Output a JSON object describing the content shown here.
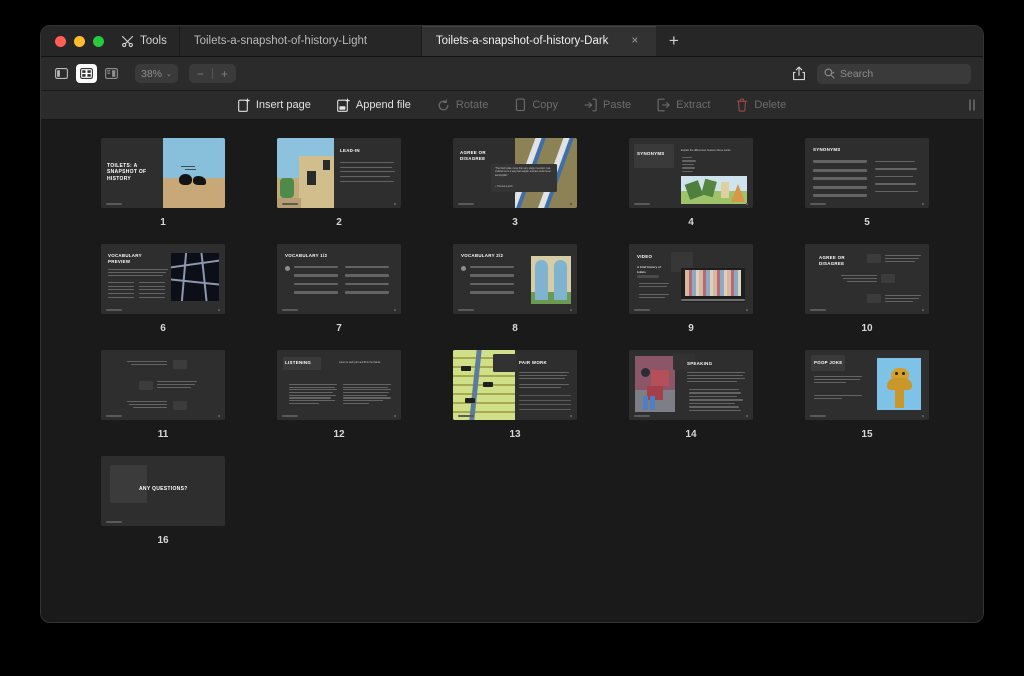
{
  "window": {
    "traffic_lights": [
      "close",
      "minimize",
      "maximize"
    ],
    "tools_label": "Tools",
    "tabs": [
      {
        "label": "Toilets-a-snapshot-of-history-Light",
        "active": false,
        "closable": false
      },
      {
        "label": "Toilets-a-snapshot-of-history-Dark",
        "active": true,
        "closable": true,
        "close_glyph": "×"
      }
    ],
    "new_tab_glyph": "+"
  },
  "toolbar": {
    "view_modes": [
      {
        "name": "sidebar-view",
        "active": false
      },
      {
        "name": "grid-view",
        "active": true
      },
      {
        "name": "split-view",
        "active": false
      }
    ],
    "zoom_value": "38%",
    "zoom_chevron": "⌄",
    "zoom_out": "−",
    "zoom_in": "+",
    "share_icon": "share-icon",
    "search": {
      "placeholder": "Search",
      "value": ""
    }
  },
  "actions": [
    {
      "label": "Insert page",
      "icon": "insert-page-icon",
      "enabled": true
    },
    {
      "label": "Append file",
      "icon": "append-file-icon",
      "enabled": true
    },
    {
      "label": "Rotate",
      "icon": "rotate-icon",
      "enabled": false
    },
    {
      "label": "Copy",
      "icon": "copy-icon",
      "enabled": false
    },
    {
      "label": "Paste",
      "icon": "paste-icon",
      "enabled": false
    },
    {
      "label": "Extract",
      "icon": "extract-icon",
      "enabled": false
    },
    {
      "label": "Delete",
      "icon": "trash-icon",
      "enabled": false
    }
  ],
  "pages": [
    {
      "number": "1",
      "title": "TOILETS: A SNAPSHOT OF HISTORY",
      "layout": "title-left-image-right"
    },
    {
      "number": "2",
      "title": "LEAD-IN",
      "layout": "image-left-list-right"
    },
    {
      "number": "3",
      "title": "AGREE OR DISAGREE",
      "quote": "“The flush toilet, more than any single invention, has civilized us in a way that religion and law could never accomplish.”",
      "attribution": "– Thomas Lynch",
      "layout": "title-left-quote-over-image"
    },
    {
      "number": "4",
      "title": "SYNONYMS",
      "subtitle": "Explain the differences between these words",
      "layout": "title-left-list-image-right"
    },
    {
      "number": "5",
      "title": "SYNONYMS",
      "layout": "two-column-definitions"
    },
    {
      "number": "6",
      "title": "VOCABULARY PREVIEW",
      "layout": "checklist-left-image-right"
    },
    {
      "number": "7",
      "title": "VOCABULARY 1/2",
      "layout": "two-column-terms"
    },
    {
      "number": "8",
      "title": "VOCABULARY 2/2",
      "layout": "terms-left-image-right"
    },
    {
      "number": "9",
      "title": "VIDEO",
      "subtitle": "A brief history of toilets",
      "layout": "video-left-laptop-right"
    },
    {
      "number": "10",
      "title": "AGREE OR DISAGREE",
      "layout": "zigzag-statements"
    },
    {
      "number": "11",
      "title": "",
      "layout": "zigzag-statements"
    },
    {
      "number": "12",
      "title": "LISTENING",
      "subtitle": "Listen to each part and fill in the blanks",
      "layout": "two-task-columns"
    },
    {
      "number": "13",
      "title": "PAIR WORK",
      "layout": "image-left-lines-right"
    },
    {
      "number": "14",
      "title": "SPEAKING",
      "layout": "image-left-list-right"
    },
    {
      "number": "15",
      "title": "POOP JOKE",
      "layout": "text-left-image-right"
    },
    {
      "number": "16",
      "title": "ANY QUESTIONS?",
      "layout": "closing"
    }
  ],
  "colors": {
    "window_bg": "#1d1d1d",
    "titlebar": "#262626",
    "toolbar": "#2b2b2b",
    "canvas": "#1a1a1a",
    "slide_bg": "#2e2e2e",
    "accent_red": "#c9544d",
    "text_primary": "#e2e2e2",
    "text_disabled": "#6d6d6d"
  }
}
